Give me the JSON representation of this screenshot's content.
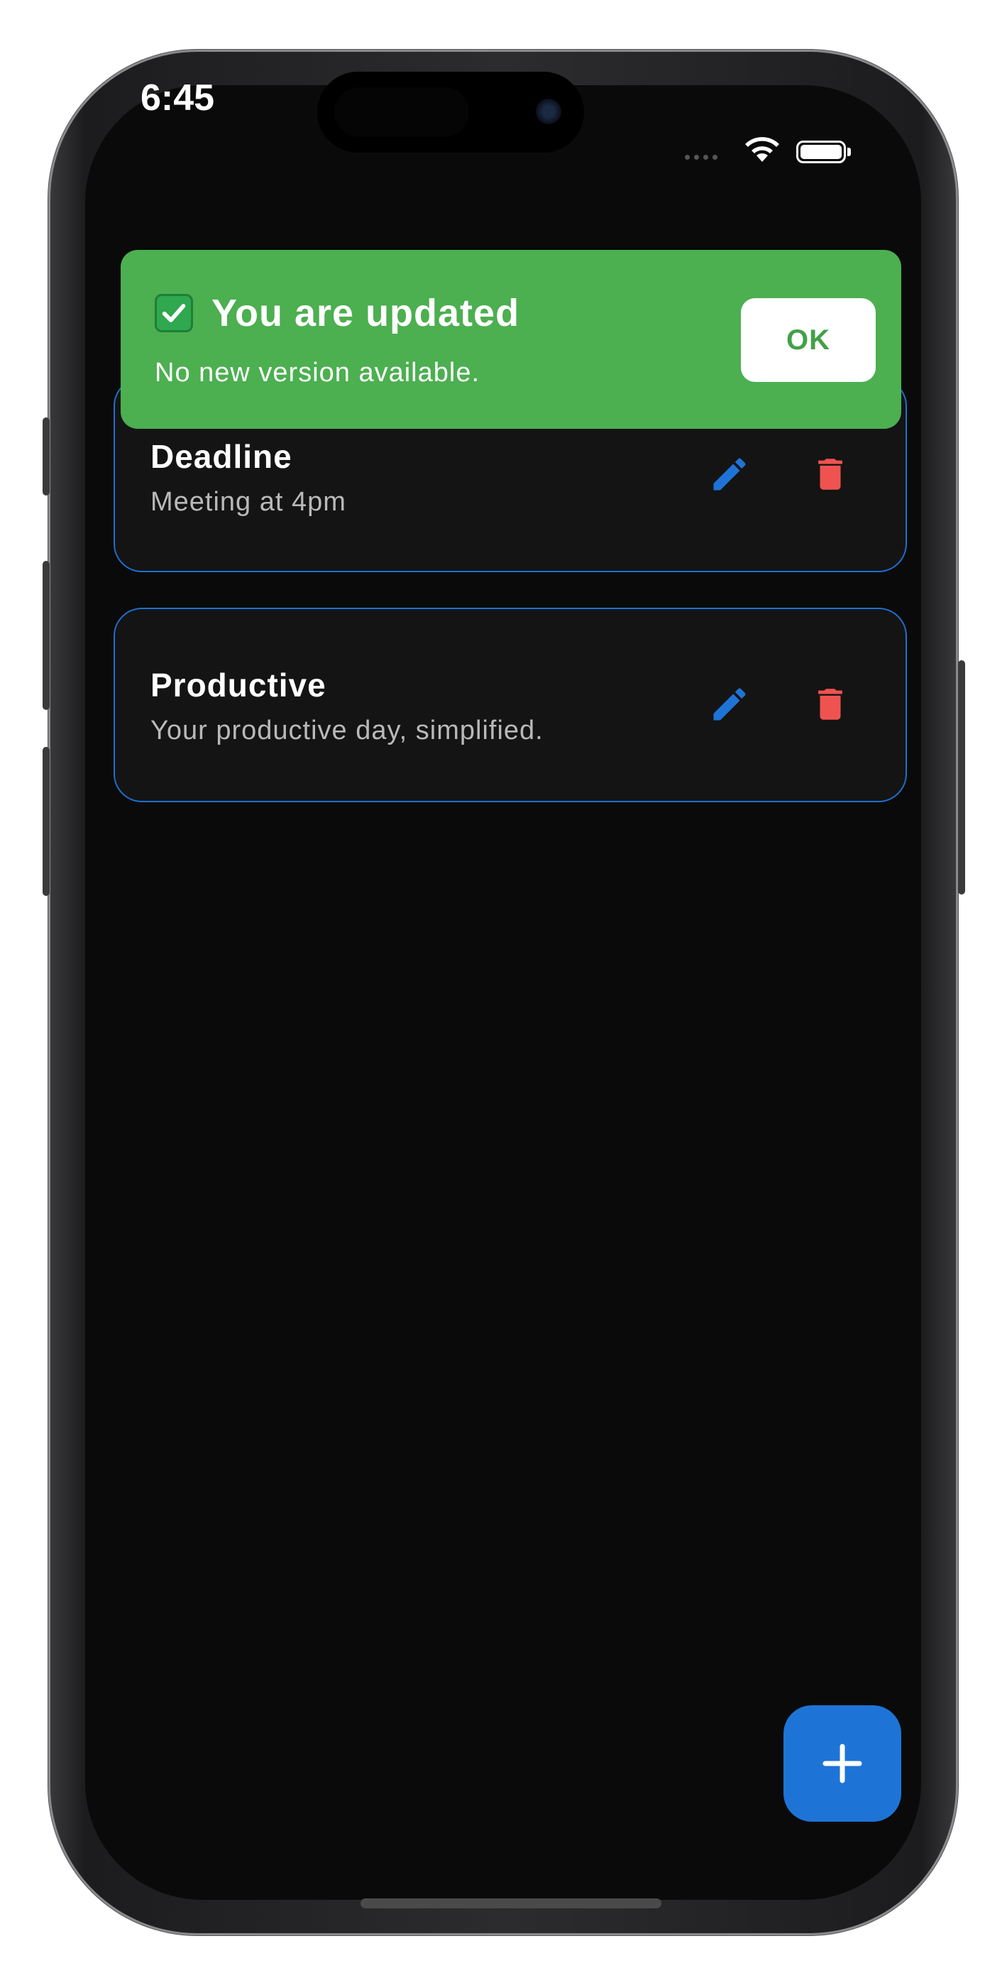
{
  "status_bar": {
    "time": "6:45"
  },
  "toast": {
    "title": "You are updated",
    "message": "No new version available.",
    "ok_label": "OK",
    "background": "#4caf50"
  },
  "notes": [
    {
      "title": "Deadline",
      "subtitle": "Meeting at 4pm"
    },
    {
      "title": "Productive",
      "subtitle": "Your productive day, simplified."
    }
  ],
  "icons": {
    "edit": "pencil-icon",
    "delete": "trash-icon",
    "add": "plus-icon",
    "status": "check-icon"
  },
  "colors": {
    "accent": "#1e74d6",
    "delete": "#ef5350",
    "card_border": "#1f6fd1"
  }
}
